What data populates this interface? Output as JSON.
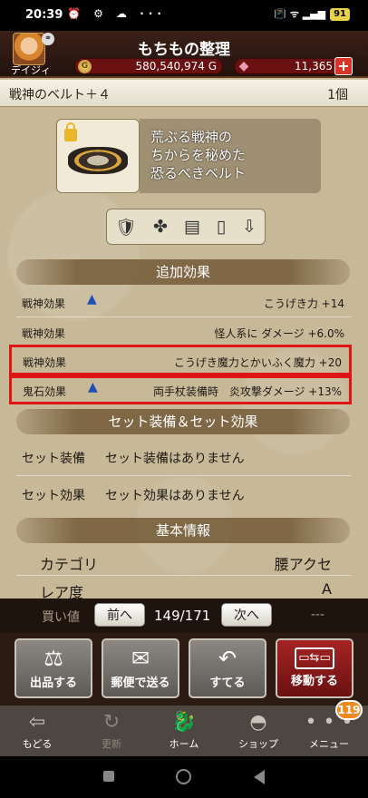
{
  "status_bar": {
    "time": "20:39",
    "left_icons": "⏰ ⚙ ☁ ··· ",
    "right_icons": "📳 ᯤ ▂▄▆",
    "battery": "91"
  },
  "header": {
    "title": "もちもの整理",
    "avatar_name": "デイジィ",
    "gold": "580,540,974 G",
    "gems": "11,365",
    "plus_label": "+"
  },
  "item": {
    "name": "戦神のベルト＋４",
    "count": "1個",
    "description": "荒ぶる戦神の\nちからを秘めた\n恐るべきベルト",
    "equip_icons": [
      "🛡",
      "✤",
      "▤",
      "▯",
      "⇩"
    ]
  },
  "sections": {
    "effects": "追加効果",
    "set": "セット装備＆セット効果",
    "basic": "基本情報"
  },
  "effects": [
    {
      "label": "戦神効果",
      "value": "こうげき力 +14",
      "slime": true
    },
    {
      "label": "戦神効果",
      "value": "怪人系に ダメージ +6.0%",
      "slime": false
    },
    {
      "label": "戦神効果",
      "value": "こうげき魔力とかいふく魔力 +20",
      "slime": false
    },
    {
      "label": "鬼石効果",
      "value": "両手杖装備時　炎攻撃ダメージ +13%",
      "slime": true
    }
  ],
  "set_rows": [
    {
      "label": "セット装備",
      "value": "セット装備はありません"
    },
    {
      "label": "セット効果",
      "value": "セット効果はありません"
    }
  ],
  "basic_rows": [
    {
      "label": "カテゴリ",
      "value": "腰アクセ"
    },
    {
      "label": "レア度",
      "value": "A"
    }
  ],
  "pager": {
    "buy_label": "買い値",
    "prev": "前へ",
    "page": "149/171",
    "next": "次へ",
    "price": "---"
  },
  "actions": [
    {
      "label": "出品する",
      "icon": "⚖"
    },
    {
      "label": "郵便で送る",
      "icon": "✉"
    },
    {
      "label": "すてる",
      "icon": "↶"
    },
    {
      "label": "移動する",
      "icon": "▭⇆▭"
    }
  ],
  "nav": [
    {
      "label": "もどる",
      "icon": "⇦"
    },
    {
      "label": "更新",
      "icon": "↻"
    },
    {
      "label": "ホーム",
      "icon": "🐉"
    },
    {
      "label": "ショップ",
      "icon": "◓"
    },
    {
      "label": "メニュー",
      "icon": "• • •"
    }
  ],
  "nav_badge": "119"
}
